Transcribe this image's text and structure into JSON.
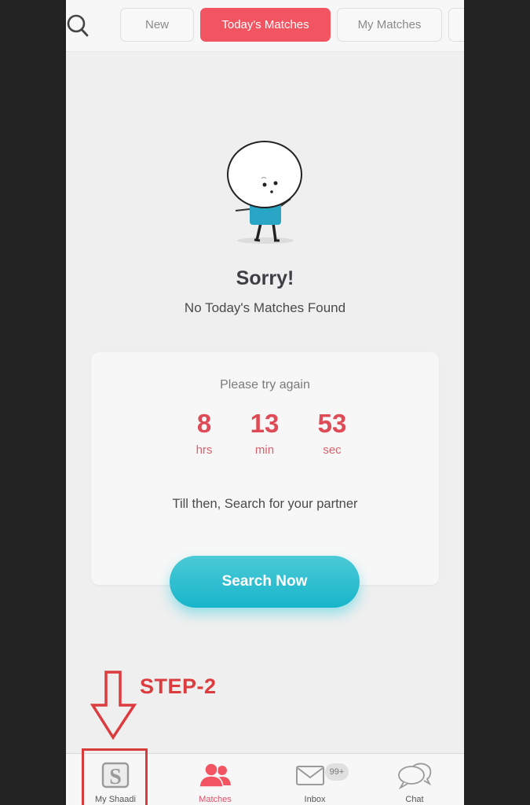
{
  "top_tabs": [
    {
      "label": "New",
      "active": false
    },
    {
      "label": "Today's Matches",
      "active": true
    },
    {
      "label": "My Matches",
      "active": false
    }
  ],
  "empty_state": {
    "title": "Sorry!",
    "message": "No Today's Matches Found"
  },
  "countdown_card": {
    "prompt": "Please try again",
    "hours": {
      "value": "8",
      "unit": "hrs"
    },
    "minutes": {
      "value": "13",
      "unit": "min"
    },
    "seconds": {
      "value": "53",
      "unit": "sec"
    },
    "hint": "Till then, Search for your partner"
  },
  "search_now_label": "Search Now",
  "annotation": {
    "label": "STEP-2",
    "color": "#dd3c3e"
  },
  "bottom_nav": {
    "items": [
      {
        "label": "My Shaadi",
        "icon": "shaadi-logo-icon"
      },
      {
        "label": "Matches",
        "icon": "people-icon",
        "active": true
      },
      {
        "label": "Inbox",
        "icon": "mail-icon",
        "badge": "99+"
      },
      {
        "label": "Chat",
        "icon": "chat-bubbles-icon"
      }
    ]
  },
  "colors": {
    "accent": "#f25561",
    "countdown": "#de4a55",
    "button": "#17b5cb"
  }
}
